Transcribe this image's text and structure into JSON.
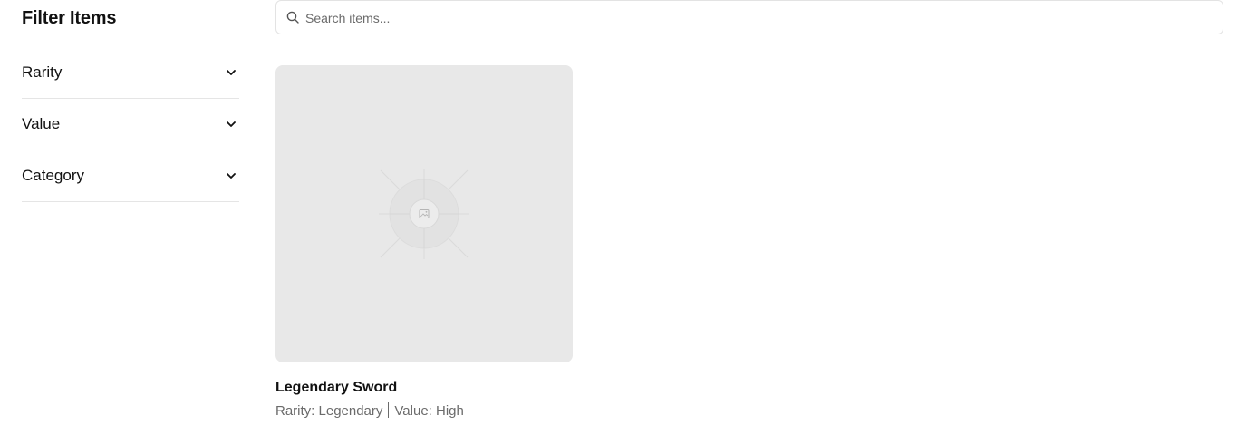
{
  "sidebar": {
    "title": "Filter Items",
    "filters": [
      {
        "label": "Rarity",
        "icon": "chevron-down-icon"
      },
      {
        "label": "Value",
        "icon": "chevron-down-icon"
      },
      {
        "label": "Category",
        "icon": "chevron-down-icon"
      }
    ]
  },
  "search": {
    "placeholder": "Search items...",
    "value": "",
    "icon": "search-icon"
  },
  "items": [
    {
      "name": "Legendary Sword",
      "rarity_text": "Rarity: Legendary",
      "value_text": "Value: High",
      "image": "image-placeholder-icon"
    }
  ],
  "colors": {
    "image_placeholder_bg": "#e8e8e8",
    "muted_text": "#6b6b6b",
    "divider": "#e5e5e5"
  }
}
